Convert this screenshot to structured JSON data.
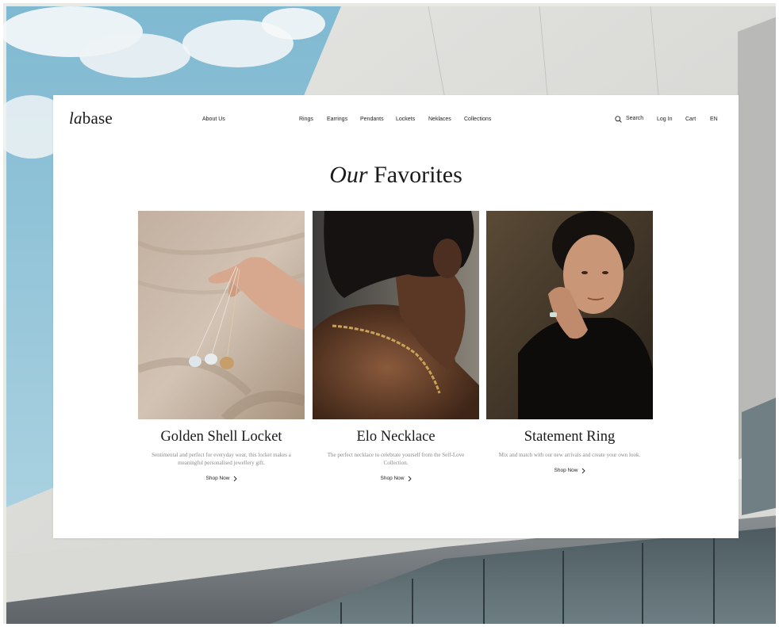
{
  "logo": {
    "italic": "la",
    "regular": "base"
  },
  "nav": {
    "about": "About Us",
    "categories": [
      "Rings",
      "Earrings",
      "Pendants",
      "Lockets",
      "Neklaces",
      "Collections"
    ],
    "search": "Search",
    "login": "Log In",
    "cart": "Cart",
    "language": "EN"
  },
  "section": {
    "title_italic": "Our",
    "title_regular": "Favorites"
  },
  "products": [
    {
      "name": "Golden Shell Locket",
      "description": "Sentimental and perfect for everyday wear, this locket makes a meaningful personalised jewellery gift.",
      "cta": "Shop Now"
    },
    {
      "name": "Elo Necklace",
      "description": "The perfect necklace to celebrate yourself from the Self-Love Collection.",
      "cta": "Shop Now"
    },
    {
      "name": "Statement Ring",
      "description": "Mix and match with our new arrivals and create your own look.",
      "cta": "Shop Now"
    }
  ],
  "icons": {
    "search": "search-icon",
    "cta_arrow": "chevron-right-icon"
  },
  "colors": {
    "text": "#1a1a1a",
    "muted": "#8a8a8a",
    "card_background": "#ffffff",
    "sky": "#8fc3d8"
  }
}
